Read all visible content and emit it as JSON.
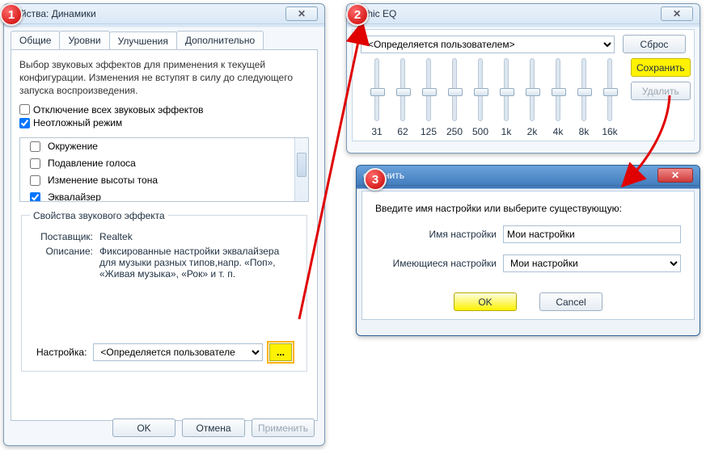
{
  "badges": [
    "1",
    "2",
    "3"
  ],
  "w1": {
    "title": "войства: Динамики",
    "tabs": [
      "Общие",
      "Уровни",
      "Улучшения",
      "Дополнительно"
    ],
    "active_tab": 2,
    "intro": "Выбор звуковых эффектов для применения к текущей конфигурации. Изменения не вступят в силу до следующего запуска воспроизведения.",
    "disable_all": "Отключение всех звуковых эффектов",
    "immediate": "Неотложный режим",
    "effects": [
      {
        "label": "Окружение",
        "checked": false
      },
      {
        "label": "Подавление голоса",
        "checked": false
      },
      {
        "label": "Изменение высоты тона",
        "checked": false
      },
      {
        "label": "Эквалайзер",
        "checked": true
      }
    ],
    "props_legend": "Свойства звукового эффекта",
    "provider_k": "Поставщик:",
    "provider_v": "Realtek",
    "descr_k": "Описание:",
    "descr_v": "Фиксированные настройки эквалайзера для музыки разных типов,напр. «Поп», «Живая музыка», «Рок» и т. п.",
    "setting_k": "Настройка:",
    "setting_v": "<Определяется пользователе",
    "ellipsis": "...",
    "ok": "OK",
    "cancel": "Отмена",
    "apply": "Применить"
  },
  "w2": {
    "title": "raphic EQ",
    "preset": "<Определяется пользователем>",
    "reset": "Сброс",
    "save": "Сохранить",
    "delete": "Удалить",
    "bands": [
      "31",
      "62",
      "125",
      "250",
      "500",
      "1k",
      "2k",
      "4k",
      "8k",
      "16k"
    ],
    "positions": [
      36,
      36,
      36,
      36,
      36,
      36,
      36,
      36,
      36,
      36
    ]
  },
  "w3": {
    "title": "охранить",
    "prompt": "Введите имя настройки или выберите существующую:",
    "name_label": "Имя настройки",
    "name_value": "Мои настройки",
    "existing_label": "Имеющиеся настройки",
    "existing_value": "Мои настройки",
    "ok": "OK",
    "cancel": "Cancel"
  }
}
